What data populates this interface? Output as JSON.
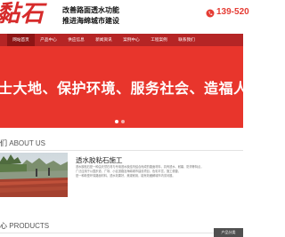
{
  "header": {
    "logo_text": "黏石",
    "slogan_line1": "改善路面透水功能",
    "slogan_line2": "推进海绵城市建设",
    "phone": "139-520"
  },
  "nav": {
    "items": [
      {
        "label": "网站首页"
      },
      {
        "label": "产品中心"
      },
      {
        "label": "供应信息"
      },
      {
        "label": "新闻资讯"
      },
      {
        "label": "案例中心"
      },
      {
        "label": "工程案例"
      },
      {
        "label": "联系我们"
      }
    ]
  },
  "banner": {
    "headline": "士大地、保护环境、服务社会、造福人"
  },
  "about": {
    "title_cn": "们",
    "title_en": "ABOUT US",
    "heading": "透水胶粘石施工",
    "body": [
      "透水胶粘石是一种由天然石材与专用透水胶结剂结合而成的路面材料，具有透水、耐磨、防滑等特点，",
      "广泛应用于公园步道、广场、小区道路及海绵城市建设项目，色彩丰富，施工便捷，",
      "是一种新型环保路面材料，透水效果好，美观耐用，能有效缓解城市内涝问题。"
    ]
  },
  "products": {
    "title_cn": "心",
    "title_en": "PRODUCTS",
    "side_tab": "产品分类"
  },
  "colors": {
    "brand_red": "#d62b2b",
    "nav_red": "#b52525",
    "banner_red": "#e8352c"
  }
}
